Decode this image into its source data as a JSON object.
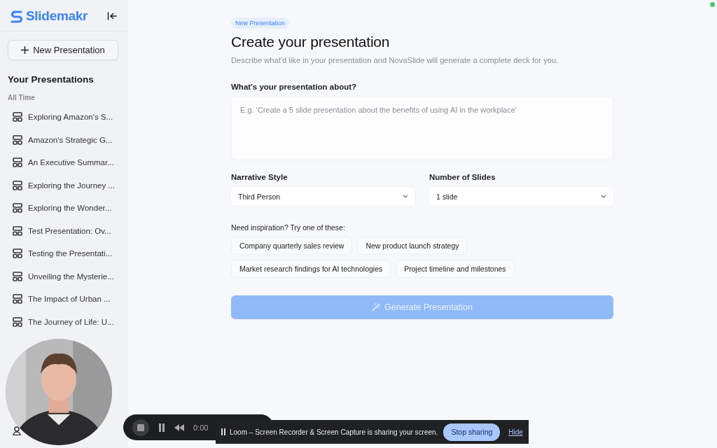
{
  "sidebar": {
    "logo": "Slidemakr",
    "new_button": "New Presentation",
    "heading": "Your Presentations",
    "section": "All Time",
    "items": [
      {
        "title": "Exploring Amazon's S..."
      },
      {
        "title": "Amazon's Strategic G..."
      },
      {
        "title": "An Executive Summar..."
      },
      {
        "title": "Exploring the Journey ..."
      },
      {
        "title": "Exploring the Wonder..."
      },
      {
        "title": "Test Presentation: Ov..."
      },
      {
        "title": "Testing the Presentati..."
      },
      {
        "title": "Unveiling the Mysterie..."
      },
      {
        "title": "The Impact of Urban ..."
      },
      {
        "title": "The Journey of Life: U..."
      }
    ]
  },
  "main": {
    "badge": "New Presentation",
    "title": "Create your presentation",
    "subtitle": "Describe what'd like in your presentation and NovaSlide will generate a complete deck for you.",
    "prompt": {
      "label": "What's your presentation about?",
      "placeholder": "E.g. 'Create a 5 slide presentation about the benefits of using AI in the workplace'"
    },
    "selects": [
      {
        "label": "Narrative Style",
        "value": "Third Person"
      },
      {
        "label": "Number of Slides",
        "value": "1 slide"
      }
    ],
    "inspiration": {
      "label": "Need inspiration? Try one of these:",
      "chips": [
        [
          "Company quarterly sales review",
          "New product launch strategy"
        ],
        [
          "Market research findings for AI technologies",
          "Project timeline and milestones"
        ]
      ]
    },
    "generate_button": {
      "label": "Generate Presentation",
      "disabled": true
    }
  },
  "recorder": {
    "time": "0:00",
    "message": "Loom – Screen Recorder & Screen Capture is sharing your screen.",
    "stop_button": "Stop sharing",
    "hide_link": "Hide"
  }
}
